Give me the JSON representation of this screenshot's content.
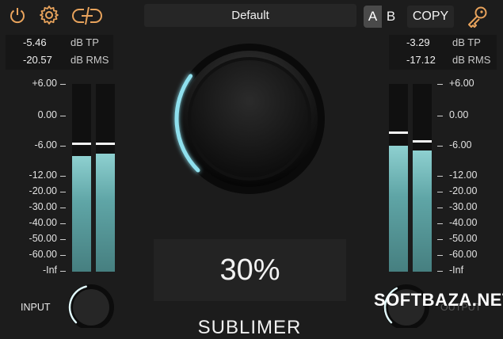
{
  "toolbar": {
    "preset_name": "Default",
    "ab_a": "A",
    "ab_b": "B",
    "copy_label": "COPY",
    "icons": [
      "power-icon",
      "gear-icon",
      "link-icon",
      "key-icon"
    ],
    "accent_color": "#e8a35c"
  },
  "left_readout": {
    "true_peak": "-5.46",
    "true_peak_unit": "dB TP",
    "rms": "-20.57",
    "rms_unit": "dB RMS"
  },
  "right_readout": {
    "true_peak": "-3.29",
    "true_peak_unit": "dB TP",
    "rms": "-17.12",
    "rms_unit": "dB RMS"
  },
  "scale": [
    "+6.00",
    "0.00",
    "-6.00",
    "-12.00",
    "-20.00",
    "-30.00",
    "-40.00",
    "-50.00",
    "-60.00",
    "-Inf"
  ],
  "input_meters": [
    {
      "level_db": -8.0,
      "peak_db": -5.5
    },
    {
      "level_db": -7.5,
      "peak_db": -5.5
    }
  ],
  "output_meters": [
    {
      "level_db": -6.0,
      "peak_db": -3.3
    },
    {
      "level_db": -7.0,
      "peak_db": -5.0
    }
  ],
  "main_knob": {
    "value": "30%",
    "amount": 0.3,
    "glow_color": "#8fe0ee"
  },
  "input_knob": {
    "label": "INPUT",
    "amount": 0.45
  },
  "output_knob": {
    "label": "OUTPUT",
    "amount": 0.4
  },
  "brand": "SUBLIMER",
  "watermark": "SOFTBAZA.NET"
}
